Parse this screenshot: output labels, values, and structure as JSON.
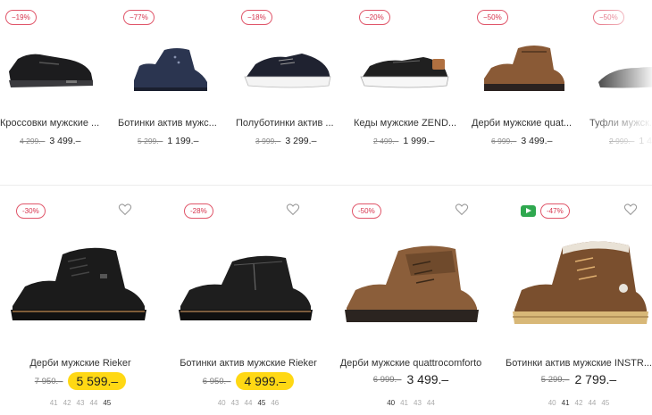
{
  "top_products": [
    {
      "discount": "−19%",
      "title": "Кроссовки мужские ...",
      "old_price": "4 299.–",
      "price": "3 499.–",
      "shoe": "sneaker-black"
    },
    {
      "discount": "−77%",
      "title": "Ботинки актив мужс...",
      "old_price": "5 299.–",
      "price": "1 199.–",
      "shoe": "boot-navy"
    },
    {
      "discount": "−18%",
      "title": "Полуботинки актив ...",
      "old_price": "3 999.–",
      "price": "3 299.–",
      "shoe": "sneaker-white-sole"
    },
    {
      "discount": "−20%",
      "title": "Кеды мужские ZEND...",
      "old_price": "2 499.–",
      "price": "1 999.–",
      "shoe": "canvas-black"
    },
    {
      "discount": "−50%",
      "title": "Дерби мужские quat...",
      "old_price": "6 999.–",
      "price": "3 499.–",
      "shoe": "boot-brown"
    },
    {
      "discount": "−50%",
      "title": "Туфли мужск...",
      "old_price": "2 999.–",
      "price": "1 4...",
      "shoe": "loafer-black"
    }
  ],
  "products": [
    {
      "discount": "-30%",
      "title": "Дерби мужские Rieker",
      "old_price": "7 950.–",
      "price": "5 599.–",
      "highlight": true,
      "has_video": false,
      "sizes": [
        {
          "v": "41",
          "a": false
        },
        {
          "v": "42",
          "a": false
        },
        {
          "v": "43",
          "a": false
        },
        {
          "v": "44",
          "a": false
        },
        {
          "v": "45",
          "a": true
        }
      ]
    },
    {
      "discount": "-28%",
      "title": "Ботинки актив мужские Rieker",
      "old_price": "6 950.–",
      "price": "4 999.–",
      "highlight": true,
      "has_video": false,
      "sizes": [
        {
          "v": "40",
          "a": false
        },
        {
          "v": "43",
          "a": false
        },
        {
          "v": "44",
          "a": false
        },
        {
          "v": "45",
          "a": true
        },
        {
          "v": "46",
          "a": false
        }
      ]
    },
    {
      "discount": "-50%",
      "title": "Дерби мужские quattrocomforto",
      "old_price": "6 999.–",
      "price": "3 499.–",
      "highlight": false,
      "has_video": false,
      "sizes": [
        {
          "v": "40",
          "a": true
        },
        {
          "v": "41",
          "a": false
        },
        {
          "v": "43",
          "a": false
        },
        {
          "v": "44",
          "a": false
        }
      ]
    },
    {
      "discount": "-47%",
      "title": "Ботинки актив мужские INSTR...",
      "old_price": "5 299.–",
      "price": "2 799.–",
      "highlight": false,
      "has_video": true,
      "sizes": [
        {
          "v": "40",
          "a": false
        },
        {
          "v": "41",
          "a": true
        },
        {
          "v": "42",
          "a": false
        },
        {
          "v": "44",
          "a": false
        },
        {
          "v": "45",
          "a": false
        }
      ]
    }
  ],
  "colors": {
    "badge": "#d6334c",
    "highlight": "#ffd814",
    "video": "#2fa84f"
  }
}
